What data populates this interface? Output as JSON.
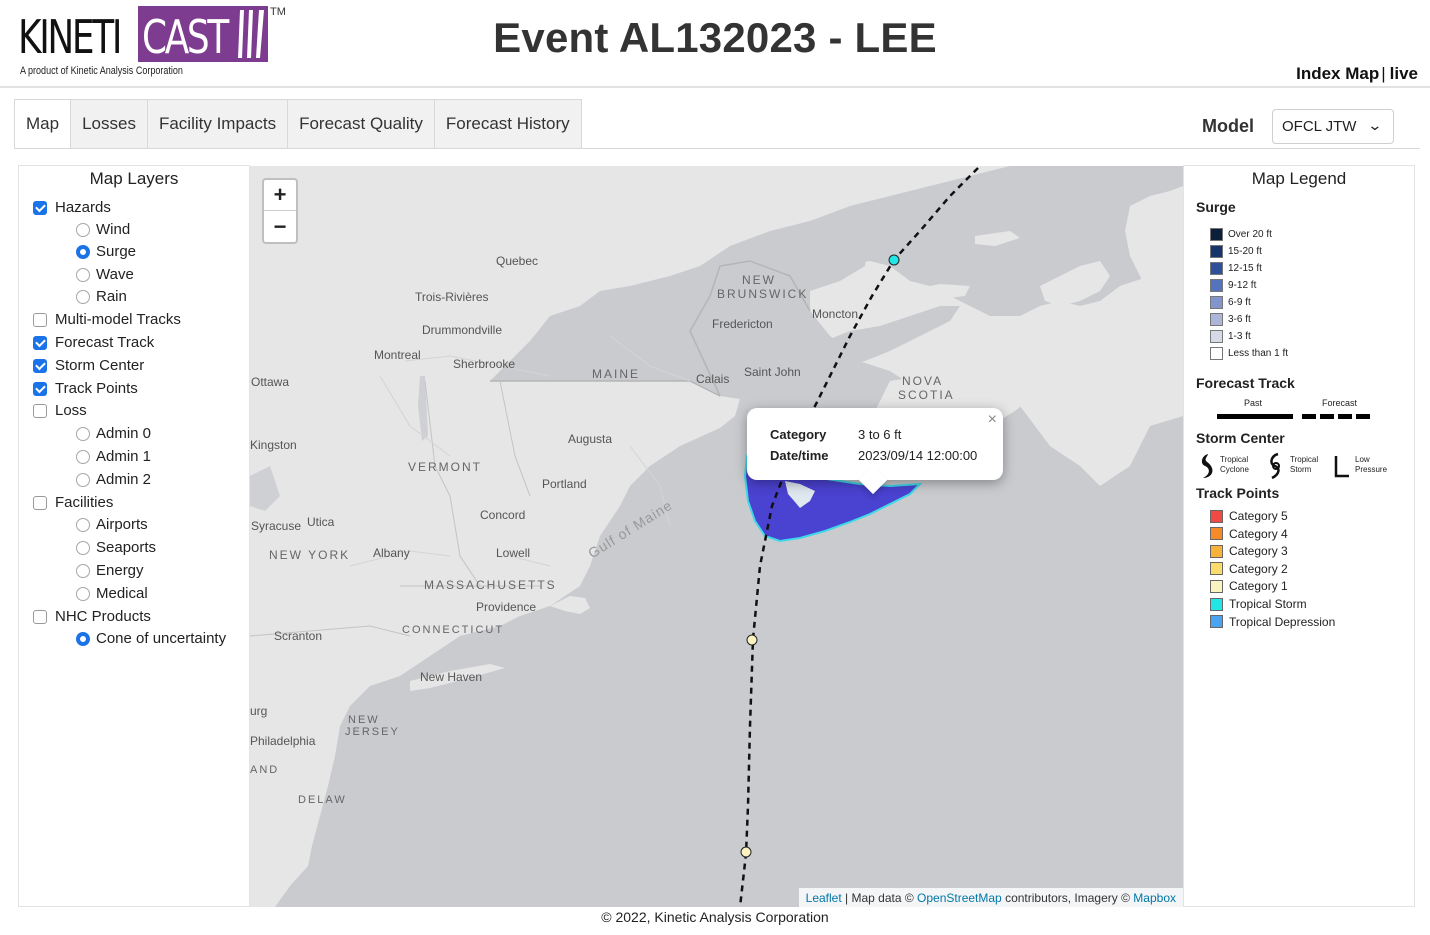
{
  "header": {
    "logo_kinetic": "KINETI",
    "logo_cast": "CAST",
    "logo_tm": "TM",
    "logo_tagline": "A product of Kinetic Analysis Corporation",
    "title": "Event AL132023 - LEE",
    "link_index_map": "Index Map",
    "link_separator": "|",
    "link_live": "live"
  },
  "tabs": [
    "Map",
    "Losses",
    "Facility Impacts",
    "Forecast Quality",
    "Forecast History"
  ],
  "active_tab": "Map",
  "model": {
    "label": "Model",
    "selected": "OFCL JTW"
  },
  "layers": {
    "title": "Map Layers",
    "hazards": "Hazards",
    "wind": "Wind",
    "surge": "Surge",
    "wave": "Wave",
    "rain": "Rain",
    "multi_model_tracks": "Multi-model Tracks",
    "forecast_track": "Forecast Track",
    "storm_center": "Storm Center",
    "track_points": "Track Points",
    "loss": "Loss",
    "admin0": "Admin 0",
    "admin1": "Admin 1",
    "admin2": "Admin 2",
    "facilities": "Facilities",
    "airports": "Airports",
    "seaports": "Seaports",
    "energy": "Energy",
    "medical": "Medical",
    "nhc_products": "NHC Products",
    "cone": "Cone of uncertainty"
  },
  "map": {
    "zoom_in": "+",
    "zoom_out": "−",
    "popup": {
      "category_label": "Category",
      "category_value": "3 to 6 ft",
      "datetime_label": "Date/time",
      "datetime_value": "2023/09/14 12:00:00",
      "close": "×"
    },
    "attribution": {
      "leaflet": "Leaflet",
      "sep1": " | Map data © ",
      "osm": "OpenStreetMap",
      "mid": " contributors, Imagery © ",
      "mapbox": "Mapbox"
    },
    "labels": {
      "quebec": "Quebec",
      "trois_rivieres": "Trois-Rivières",
      "drummondville": "Drummondville",
      "montreal": "Montreal",
      "sherbrooke": "Sherbrooke",
      "ottawa": "Ottawa",
      "new_brunswick_1": "NEW",
      "new_brunswick_2": "BRUNSWICK",
      "fredericton": "Fredericton",
      "moncton": "Moncton",
      "saint_john": "Saint John",
      "calais": "Calais",
      "maine": "MAINE",
      "nova_scotia_1": "NOVA",
      "nova_scotia_2": "SCOTIA",
      "augusta": "Augusta",
      "vermont": "VERMONT",
      "portland": "Portland",
      "concord": "Concord",
      "gulf_of_maine": "Gulf of Maine",
      "syracuse": "Syracuse",
      "utica": "Utica",
      "new_york": "NEW YORK",
      "albany": "Albany",
      "lowell": "Lowell",
      "massachusetts": "MASSACHUSETTS",
      "providence": "Providence",
      "connecticut": "CONNECTICUT",
      "scranton": "Scranton",
      "new_haven": "New Haven",
      "new_jersey_1": "NEW",
      "new_jersey_2": "JERSEY",
      "philadelphia": "Philadelphia",
      "kingston": "Kingston",
      "harrisburg": "urg",
      "maryland": "AND",
      "delaware": "DELAW"
    }
  },
  "legend": {
    "title": "Map Legend",
    "surge_title": "Surge",
    "surge_items": [
      {
        "label": "Over 20 ft",
        "color": "#0b1f3a"
      },
      {
        "label": "15-20 ft",
        "color": "#16356b"
      },
      {
        "label": "12-15 ft",
        "color": "#2e4f9a"
      },
      {
        "label": "9-12 ft",
        "color": "#5473bd"
      },
      {
        "label": "6-9 ft",
        "color": "#8295cc"
      },
      {
        "label": "3-6 ft",
        "color": "#adb6d9"
      },
      {
        "label": "1-3 ft",
        "color": "#d6d9e6"
      },
      {
        "label": "Less than 1 ft",
        "color": "#ffffff"
      }
    ],
    "forecast_track_title": "Forecast Track",
    "past": "Past",
    "forecast": "Forecast",
    "storm_center_title": "Storm Center",
    "tropical_cyclone_1": "Tropical",
    "tropical_cyclone_2": "Cyclone",
    "tropical_storm_1": "Tropical",
    "tropical_storm_2": "Storm",
    "low_pressure_1": "Low",
    "low_pressure_2": "Pressure",
    "track_points_title": "Track Points",
    "track_items": [
      {
        "label": "Category 5",
        "color": "#f04a45"
      },
      {
        "label": "Category 4",
        "color": "#f58a28"
      },
      {
        "label": "Category 3",
        "color": "#f8b43a"
      },
      {
        "label": "Category 2",
        "color": "#fbdc6a"
      },
      {
        "label": "Category 1",
        "color": "#fbf3c0"
      },
      {
        "label": "Tropical Storm",
        "color": "#22e6e6"
      },
      {
        "label": "Tropical Depression",
        "color": "#4aa3f0"
      }
    ]
  },
  "footer": "© 2022, Kinetic Analysis Corporation"
}
